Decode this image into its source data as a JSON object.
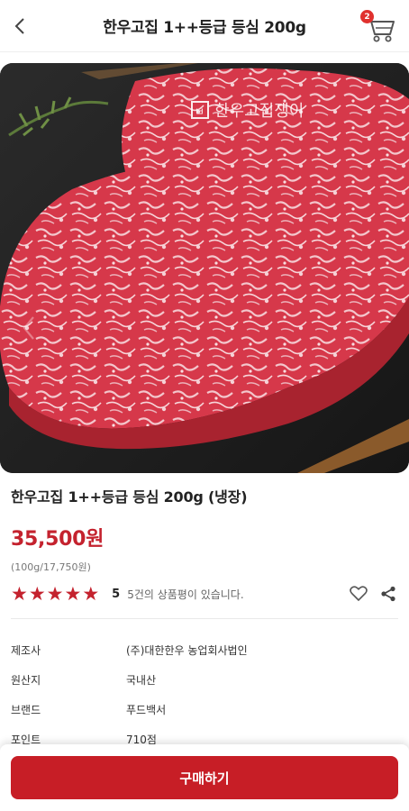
{
  "header": {
    "title": "한우고집 1++등급 등심 200g",
    "cart_count": "2"
  },
  "image": {
    "watermark": "한우고집쟁이",
    "watermark_mark": "ㅂ"
  },
  "product": {
    "name": "한우고집 1++등급 등심 200g (냉장)",
    "price": "35,500원",
    "unit_price": "(100g/17,750원)",
    "rating": 5,
    "rating_label": "5",
    "review_text": "5건의 상품평이 있습니다."
  },
  "specs": [
    {
      "label": "제조사",
      "value": "(주)대한한우 농업회사법인"
    },
    {
      "label": "원산지",
      "value": "국내산"
    },
    {
      "label": "브랜드",
      "value": "푸드백서"
    },
    {
      "label": "포인트",
      "value": "710점"
    }
  ],
  "bottom": {
    "buy_label": "구매하기"
  },
  "colors": {
    "accent": "#c4222e",
    "button": "#c71e26"
  },
  "icons": {
    "back": "chevron-left-icon",
    "cart": "cart-icon",
    "wishlist": "heart-icon",
    "share": "share-icon",
    "image_prev": "chevron-left-icon"
  }
}
